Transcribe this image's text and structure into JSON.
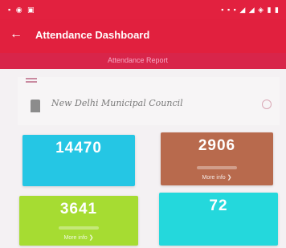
{
  "status_bar": {
    "left_icons": "▪ ◉ ▣",
    "right_icons": "▪ ▪ ▪ ◢ ◢ ◈ ▮ ▮"
  },
  "app_bar": {
    "back_icon": "←",
    "title": "Attendance Dashboard"
  },
  "sub_bar": {
    "text": "Attendance Report"
  },
  "header": {
    "council_name": "New Delhi Municipal Council"
  },
  "cards": [
    {
      "value": "14470",
      "more": "",
      "color": "#25c6e4"
    },
    {
      "value": "2906",
      "more": "More info ❯",
      "color": "#b86a4d"
    },
    {
      "value": "3641",
      "more": "More info ❯",
      "color": "#a6dc32"
    },
    {
      "value": "72",
      "more": "",
      "color": "#24d8dc"
    }
  ]
}
